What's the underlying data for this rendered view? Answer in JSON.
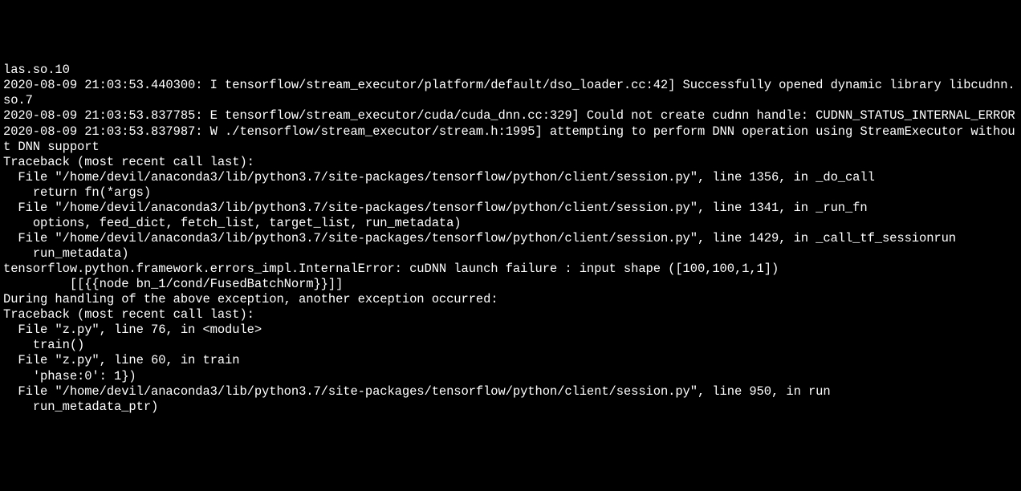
{
  "terminal": {
    "lines": [
      "las.so.10",
      "2020-08-09 21:03:53.440300: I tensorflow/stream_executor/platform/default/dso_loader.cc:42] Successfully opened dynamic library libcudnn.so.7",
      "2020-08-09 21:03:53.837785: E tensorflow/stream_executor/cuda/cuda_dnn.cc:329] Could not create cudnn handle: CUDNN_STATUS_INTERNAL_ERROR",
      "2020-08-09 21:03:53.837987: W ./tensorflow/stream_executor/stream.h:1995] attempting to perform DNN operation using StreamExecutor without DNN support",
      "Traceback (most recent call last):",
      "  File \"/home/devil/anaconda3/lib/python3.7/site-packages/tensorflow/python/client/session.py\", line 1356, in _do_call",
      "    return fn(*args)",
      "  File \"/home/devil/anaconda3/lib/python3.7/site-packages/tensorflow/python/client/session.py\", line 1341, in _run_fn",
      "    options, feed_dict, fetch_list, target_list, run_metadata)",
      "  File \"/home/devil/anaconda3/lib/python3.7/site-packages/tensorflow/python/client/session.py\", line 1429, in _call_tf_sessionrun",
      "    run_metadata)",
      "tensorflow.python.framework.errors_impl.InternalError: cuDNN launch failure : input shape ([100,100,1,1])",
      "         [[{{node bn_1/cond/FusedBatchNorm}}]]",
      "",
      "During handling of the above exception, another exception occurred:",
      "",
      "Traceback (most recent call last):",
      "  File \"z.py\", line 76, in <module>",
      "    train()",
      "  File \"z.py\", line 60, in train",
      "    'phase:0': 1})",
      "  File \"/home/devil/anaconda3/lib/python3.7/site-packages/tensorflow/python/client/session.py\", line 950, in run",
      "    run_metadata_ptr)"
    ]
  }
}
